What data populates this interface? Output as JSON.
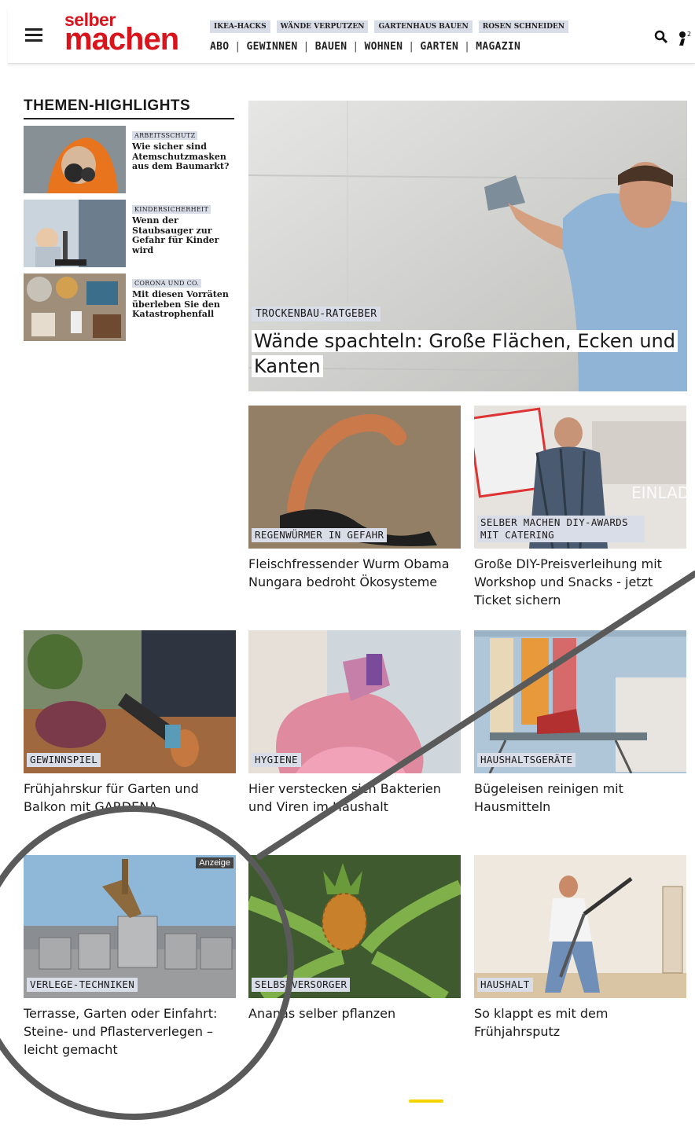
{
  "header": {
    "logo_line1": "selber",
    "logo_line2": "machen",
    "tags": [
      "IKEA-HACKS",
      "WÄNDE VERPUTZEN",
      "GARTENHAUS BAUEN",
      "ROSEN SCHNEIDEN"
    ],
    "nav": [
      "ABO",
      "GEWINNEN",
      "BAUEN",
      "WOHNEN",
      "GARTEN",
      "MAGAZIN"
    ],
    "user_badge": "2"
  },
  "sidebar": {
    "heading": "THEMEN-HIGHLIGHTS",
    "items": [
      {
        "category": "ARBEITSSCHUTZ",
        "title": "Wie sicher sind Atemschutzmasken aus dem Baumarkt?"
      },
      {
        "category": "KINDERSICHERHEIT",
        "title": "Wenn der Staubsauger zur Gefahr für Kinder wird"
      },
      {
        "category": "CORONA UND CO.",
        "title": "Mit diesen Vorräten überleben Sie den Katastrophenfall"
      }
    ]
  },
  "hero": {
    "category": "TROCKENBAU-RATGEBER",
    "title": "Wände spachteln: Große Flächen, Ecken und Kanten"
  },
  "cards": [
    {
      "category": "REGENWÜRMER IN GEFAHR",
      "title": "Fleischfressender Wurm Obama Nungara bedroht Ökosysteme"
    },
    {
      "category": "SELBER MACHEN DIY-AWARDS MIT CATERING",
      "title": "Große DIY-Preisverleihung mit Workshop und Snacks - jetzt Ticket sichern",
      "image_text": "EINLADUNG"
    },
    {
      "category": "GEWINNSPIEL",
      "title": "Frühjahrskur für Garten und Balkon mit GARDENA"
    },
    {
      "category": "HYGIENE",
      "title": "Hier verstecken sich Bakterien und Viren im Haushalt"
    },
    {
      "category": "HAUSHALTSGERÄTE",
      "title": "Bügeleisen reinigen mit Hausmitteln"
    },
    {
      "category": "VERLEGE-TECHNIKEN",
      "title": "Terrasse, Garten oder Einfahrt: Steine- und Pflasterverlegen – leicht gemacht",
      "badge": "Anzeige"
    },
    {
      "category": "SELBSTVERSORGER",
      "title": "Ananas selber pflanzen"
    },
    {
      "category": "HAUSHALT",
      "title": "So klappt es mit dem Frühjahrsputz"
    }
  ],
  "colors": {
    "brand": "#d8141d",
    "tag_bg": "#d9dde8",
    "annotation": "#5a5a5a"
  }
}
